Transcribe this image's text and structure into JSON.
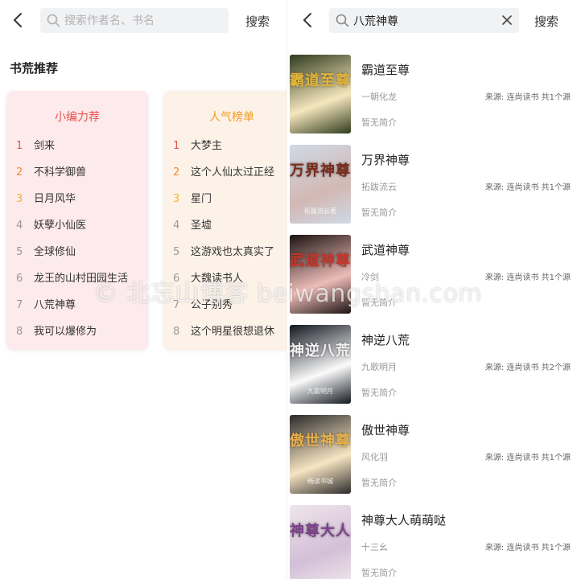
{
  "left": {
    "search": {
      "placeholder": "搜索作者名、书名",
      "button_label": "搜索"
    },
    "section_title": "书荒推荐",
    "editor_picks": {
      "title": "小编力荐",
      "items": [
        {
          "rank": "1",
          "name": "剑来"
        },
        {
          "rank": "2",
          "name": "不科学御兽"
        },
        {
          "rank": "3",
          "name": "日月风华"
        },
        {
          "rank": "4",
          "name": "妖孽小仙医"
        },
        {
          "rank": "5",
          "name": "全球修仙"
        },
        {
          "rank": "6",
          "name": "龙王的山村田园生活"
        },
        {
          "rank": "7",
          "name": "八荒神尊"
        },
        {
          "rank": "8",
          "name": "我可以爆修为"
        }
      ]
    },
    "popular": {
      "title": "人气榜单",
      "items": [
        {
          "rank": "1",
          "name": "大梦主"
        },
        {
          "rank": "2",
          "name": "这个人仙太过正经"
        },
        {
          "rank": "3",
          "name": "星门"
        },
        {
          "rank": "4",
          "name": "圣墟"
        },
        {
          "rank": "5",
          "name": "这游戏也太真实了"
        },
        {
          "rank": "6",
          "name": "大魏读书人"
        },
        {
          "rank": "7",
          "name": "公子别秀"
        },
        {
          "rank": "8",
          "name": "这个明星很想退休"
        }
      ]
    }
  },
  "right": {
    "search": {
      "value": "八荒神尊",
      "button_label": "搜索"
    },
    "results": [
      {
        "title": "霸道至尊",
        "author": "一朝化龙",
        "source": "来源: 连尚读书 共1个源",
        "intro": "暂无简介",
        "cover_text": "霸道至尊",
        "cover_subtext": "",
        "cover_bg": "#2f3b1e",
        "cover_accent": "#e2b43a"
      },
      {
        "title": "万界神尊",
        "author": "拓跋流云",
        "source": "来源: 连尚读书 共1个源",
        "intro": "暂无简介",
        "cover_text": "万界神尊",
        "cover_subtext": "拓跋流云著",
        "cover_bg": "#cfd9e6",
        "cover_accent": "#7a2a1a"
      },
      {
        "title": "武道神尊",
        "author": "冷剑",
        "source": "来源: 连尚读书 共1个源",
        "intro": "暂无简介",
        "cover_text": "武道神尊",
        "cover_subtext": "",
        "cover_bg": "#1b1210",
        "cover_accent": "#c7372b"
      },
      {
        "title": "神逆八荒",
        "author": "九歌明月",
        "source": "来源: 连尚读书 共2个源",
        "intro": "暂无简介",
        "cover_text": "神逆八荒",
        "cover_subtext": "九歌明月",
        "cover_bg": "#12161f",
        "cover_accent": "#f2f2f2"
      },
      {
        "title": "傲世神尊",
        "author": "风化羽",
        "source": "来源: 连尚读书 共1个源",
        "intro": "暂无简介",
        "cover_text": "傲世神尊",
        "cover_subtext": "畅读书城",
        "cover_bg": "#2b2b2b",
        "cover_accent": "#e8b04a"
      },
      {
        "title": "神尊大人萌萌哒",
        "author": "十三幺",
        "source": "来源: 连尚读书 共1个源",
        "intro": "暂无简介",
        "cover_text": "神尊大人",
        "cover_subtext": "",
        "cover_bg": "#efe6ea",
        "cover_accent": "#7a3f8a"
      }
    ]
  },
  "watermark": "© 北忘山博客 beiwangshan.com",
  "icons": {
    "back": "chevron-left-icon",
    "search": "search-icon",
    "clear": "close-icon"
  }
}
